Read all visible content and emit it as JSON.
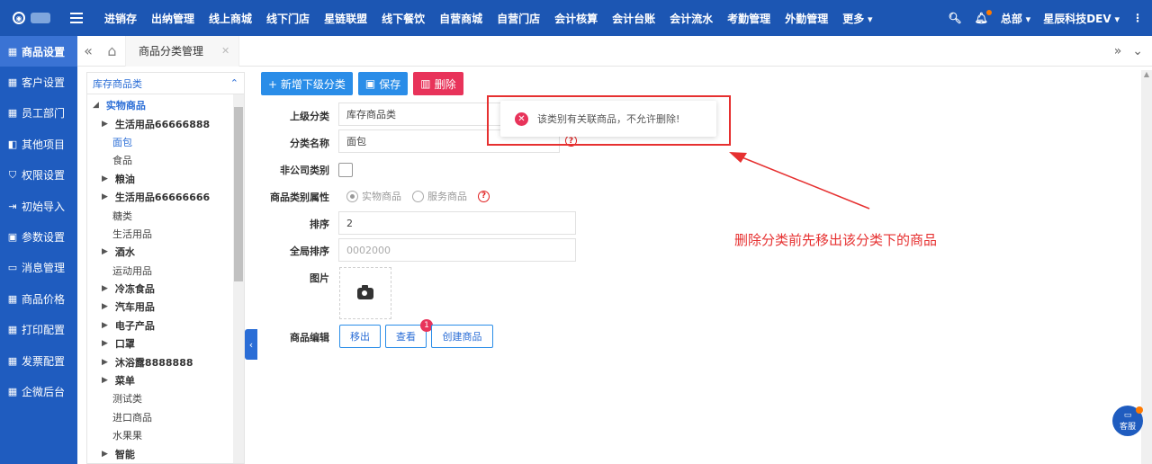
{
  "topbar": {
    "nav": [
      "进销存",
      "出纳管理",
      "线上商城",
      "线下门店",
      "星链联盟",
      "线下餐饮",
      "自营商城",
      "自营门店",
      "会计核算",
      "会计台账",
      "会计流水",
      "考勤管理",
      "外勤管理",
      "更多"
    ],
    "org": "总部",
    "company": "星辰科技DEV"
  },
  "leftnav": {
    "items": [
      "商品设置",
      "客户设置",
      "员工部门",
      "其他项目",
      "权限设置",
      "初始导入",
      "参数设置",
      "消息管理",
      "商品价格",
      "打印配置",
      "发票配置",
      "企微后台"
    ],
    "active_index": 0
  },
  "tabs": {
    "active_label": "商品分类管理"
  },
  "tree": {
    "header": "库存商品类",
    "root": "实物商品",
    "nodes": [
      {
        "label": "生活用品66666888",
        "type": "l1"
      },
      {
        "label": "面包",
        "type": "leaf",
        "selected": true
      },
      {
        "label": "食品",
        "type": "leaf"
      },
      {
        "label": "粮油",
        "type": "l1"
      },
      {
        "label": "生活用品66666666",
        "type": "l1"
      },
      {
        "label": "糖类",
        "type": "leaf"
      },
      {
        "label": "生活用品",
        "type": "leaf"
      },
      {
        "label": "酒水",
        "type": "l1"
      },
      {
        "label": "运动用品",
        "type": "leaf"
      },
      {
        "label": "冷冻食品",
        "type": "l1"
      },
      {
        "label": "汽车用品",
        "type": "l1"
      },
      {
        "label": "电子产品",
        "type": "l1"
      },
      {
        "label": "口罩",
        "type": "l1"
      },
      {
        "label": "沐浴露8888888",
        "type": "l1"
      },
      {
        "label": "菜单",
        "type": "l1"
      },
      {
        "label": "测试类",
        "type": "leaf"
      },
      {
        "label": "进口商品",
        "type": "leaf"
      },
      {
        "label": "水果果",
        "type": "leaf"
      },
      {
        "label": "智能",
        "type": "l1"
      }
    ]
  },
  "toolbar": {
    "add_label": "+ 新增下级分类",
    "save_label": "保存",
    "delete_label": "删除"
  },
  "form": {
    "parent_label": "上级分类",
    "parent_value": "库存商品类",
    "name_label": "分类名称",
    "name_value": "面包",
    "noncompany_label": "非公司类别",
    "attr_label": "商品类别属性",
    "attr_options": [
      "实物商品",
      "服务商品"
    ],
    "attr_selected": "实物商品",
    "sort_label": "排序",
    "sort_value": "2",
    "global_sort_label": "全局排序",
    "global_sort_placeholder": "0002000",
    "image_label": "图片",
    "goods_edit_label": "商品编辑",
    "move_out_label": "移出",
    "view_label": "查看",
    "view_badge": "1",
    "create_label": "创建商品",
    "help_glyph": "?"
  },
  "toast": {
    "message": "该类别有关联商品，不允许删除!"
  },
  "annotation": {
    "text": "删除分类前先移出该分类下的商品",
    "color": "#e63030"
  },
  "cs": {
    "label": "客服"
  },
  "colors": {
    "primary": "#1c56b3",
    "accent_blue": "#2a8de8",
    "danger": "#e8335a"
  }
}
